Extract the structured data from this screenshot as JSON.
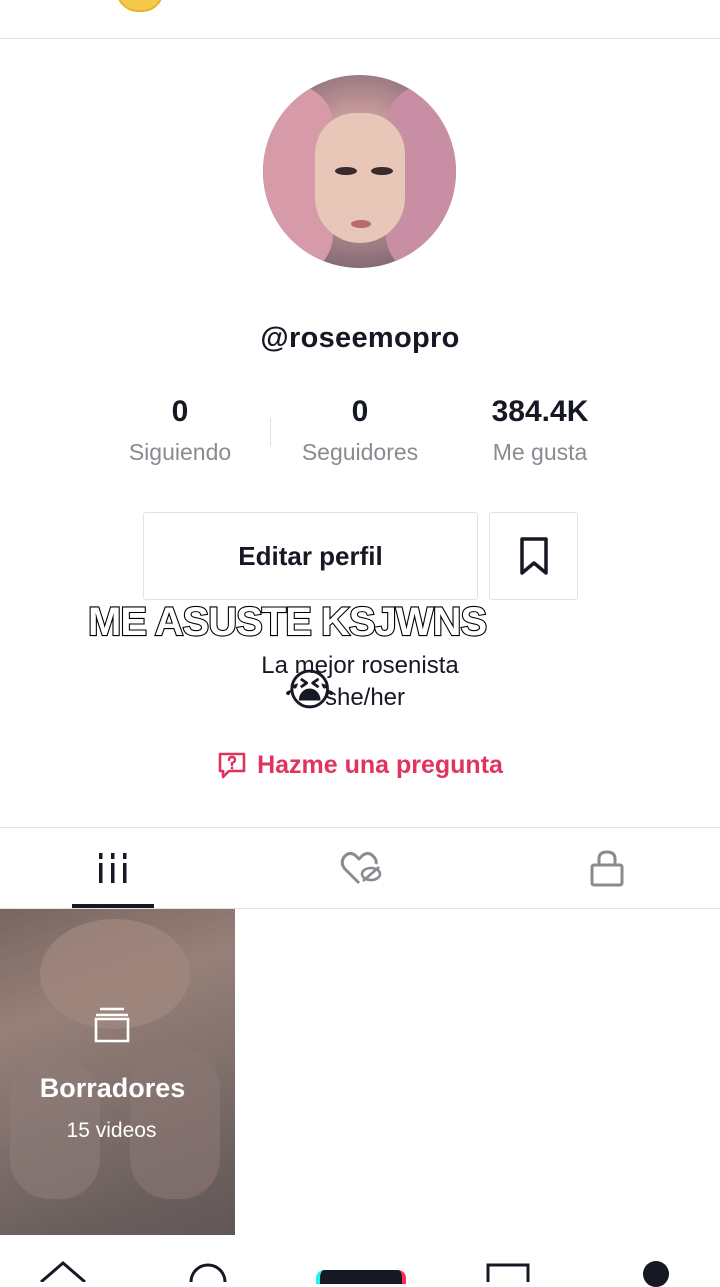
{
  "profile": {
    "username": "@roseemopro",
    "stats": [
      {
        "value": "0",
        "label": "Siguiendo"
      },
      {
        "value": "0",
        "label": "Seguidores"
      },
      {
        "value": "384.4K",
        "label": "Me gusta"
      }
    ],
    "edit_label": "Editar perfil",
    "bio_line1": "La mejor rosenista",
    "bio_line2": "she/her",
    "ask_label": "Hazme una pregunta"
  },
  "overlay": {
    "caption": "ME ASUSTE KSJWNS",
    "emoji": "😭"
  },
  "tabs": [
    {
      "icon": "grid-icon",
      "active": true
    },
    {
      "icon": "liked-hidden-icon",
      "active": false
    },
    {
      "icon": "lock-icon",
      "active": false
    }
  ],
  "drafts": {
    "title": "Borradores",
    "count": "15 videos"
  },
  "colors": {
    "accent": "#e0335f",
    "text": "#161823",
    "muted": "#8a8b91",
    "border": "#e3e3e4"
  }
}
